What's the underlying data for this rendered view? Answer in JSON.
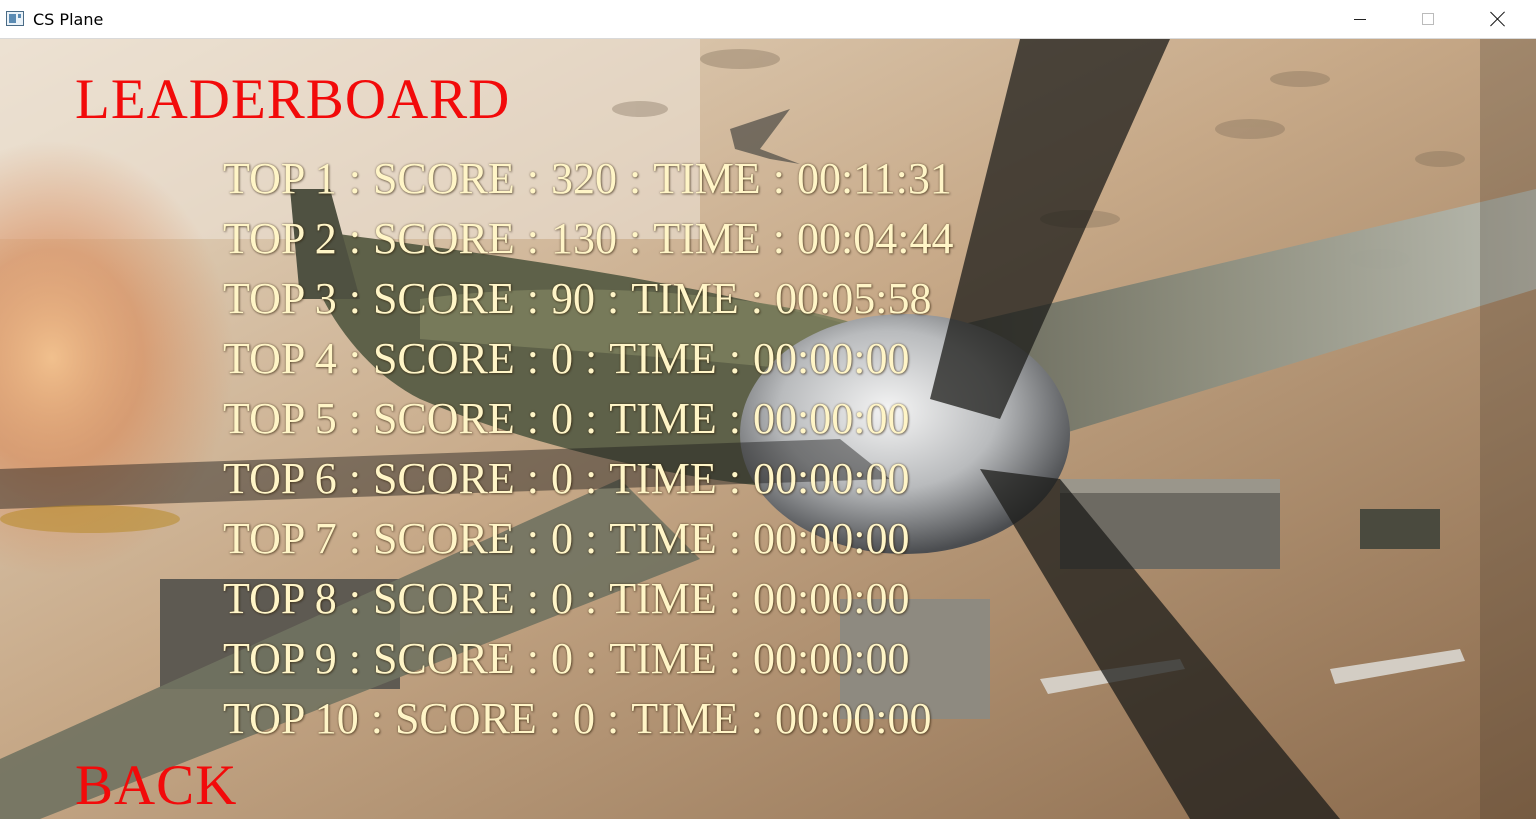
{
  "window": {
    "title": "CS Plane",
    "buttons": [
      "minimize-icon",
      "maximize-icon",
      "close-icon"
    ]
  },
  "screen": {
    "heading": "LEADERBOARD",
    "back_label": "BACK",
    "heading_color": "#f20a0a",
    "entry_color": "#fff5c7",
    "field_labels": {
      "rank_prefix": "TOP",
      "score": "SCORE",
      "time": "TIME",
      "separator": ":"
    },
    "entries": [
      {
        "rank": "1",
        "score": "320",
        "time": "00:11:31"
      },
      {
        "rank": "2",
        "score": "130",
        "time": "00:04:44"
      },
      {
        "rank": "3",
        "score": "90",
        "time": "00:05:58"
      },
      {
        "rank": "4",
        "score": "0",
        "time": "00:00:00"
      },
      {
        "rank": "5",
        "score": "0",
        "time": "00:00:00"
      },
      {
        "rank": "6",
        "score": "0",
        "time": "00:00:00"
      },
      {
        "rank": "7",
        "score": "0",
        "time": "00:00:00"
      },
      {
        "rank": "8",
        "score": "0",
        "time": "00:00:00"
      },
      {
        "rank": "9",
        "score": "0",
        "time": "00:00:00"
      },
      {
        "rank": "10",
        "score": "0",
        "time": "00:00:00"
      }
    ]
  }
}
